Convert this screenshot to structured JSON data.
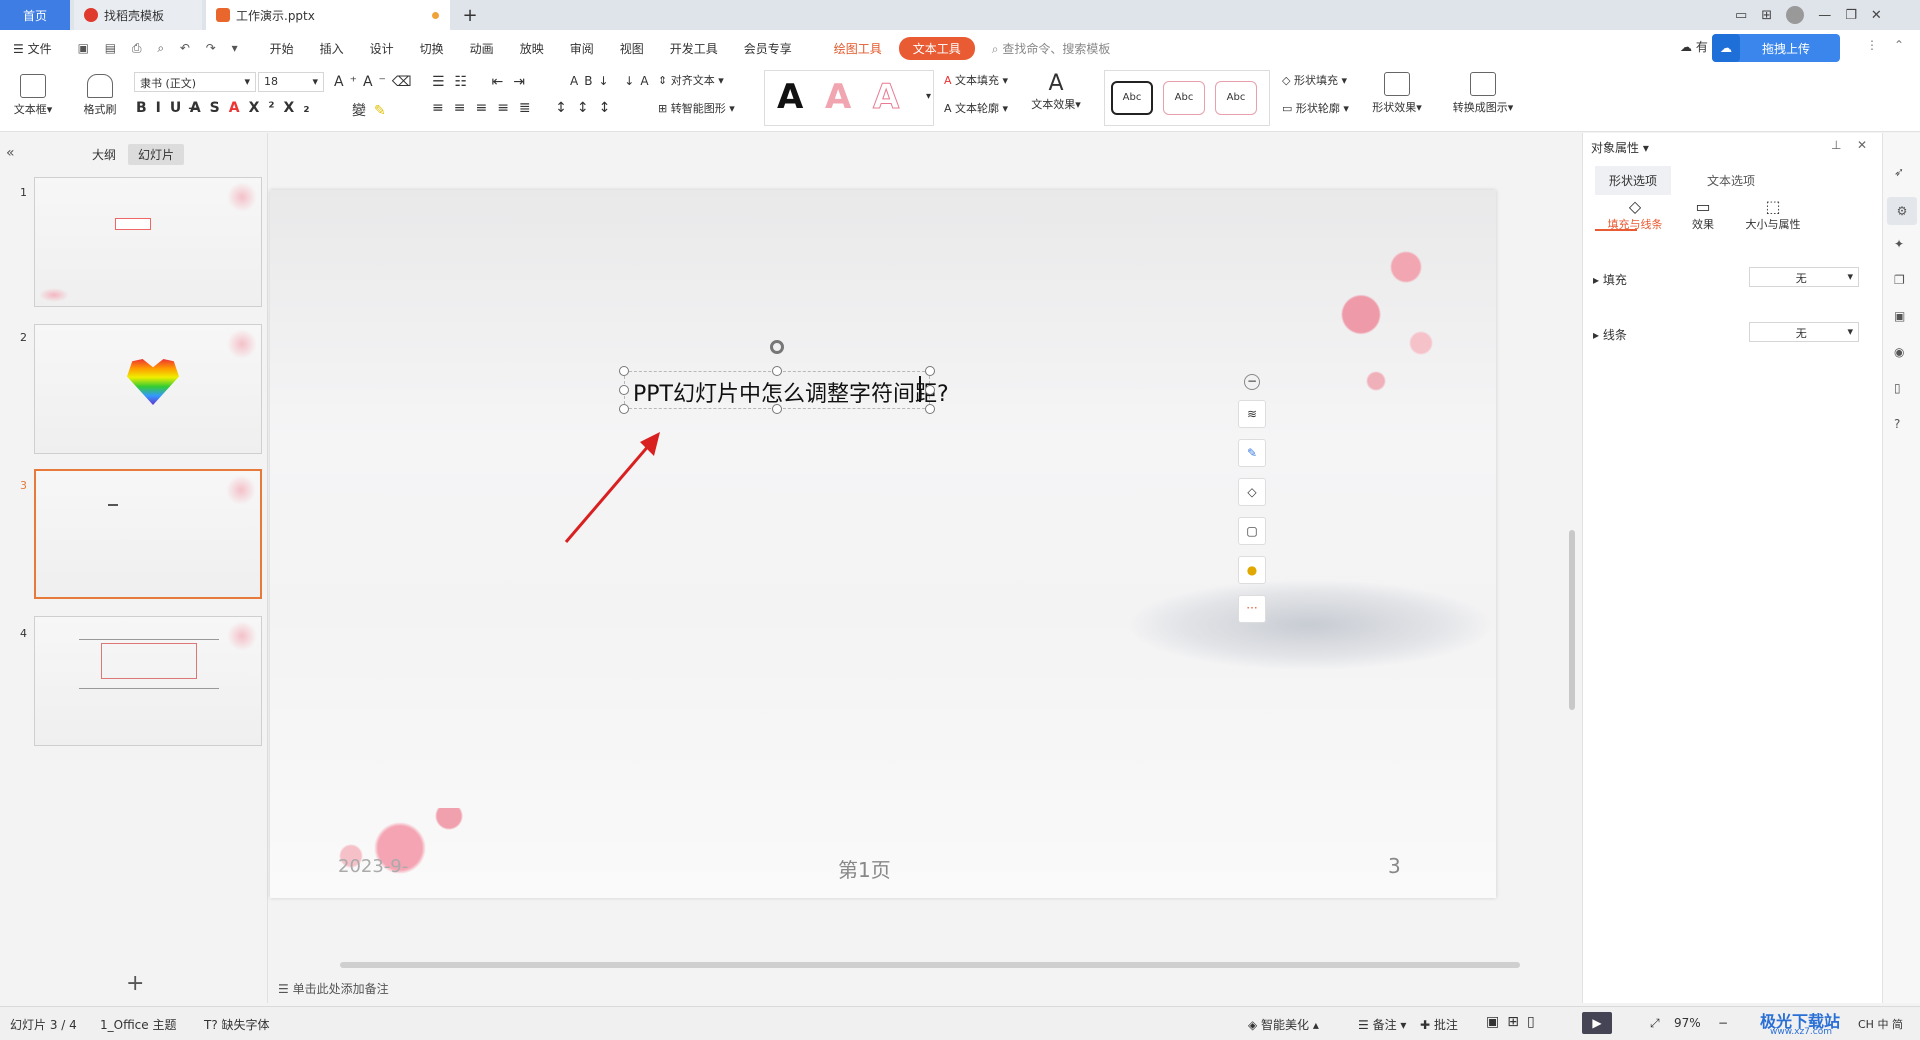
{
  "titlebar": {
    "tabs": [
      {
        "label": "首页"
      },
      {
        "label": "找稻壳模板"
      },
      {
        "label": "工作演示.pptx"
      }
    ],
    "new_tab": "+"
  },
  "menubar": {
    "file": "文件",
    "items": [
      "开始",
      "插入",
      "设计",
      "切换",
      "动画",
      "放映",
      "审阅",
      "视图",
      "开发工具",
      "会员专享"
    ],
    "drawing_tools": "绘图工具",
    "text_tools": "文本工具",
    "search_placeholder": "查找命令、搜索模板",
    "upload_btn": "拖拽上传",
    "cloud_partial": "有"
  },
  "ribbon": {
    "textbox": "文本框",
    "format_painter": "格式刷",
    "font": "隶书 (正文)",
    "size": "18",
    "align_text": "对齐文本",
    "smart_shape": "转智能图形",
    "text_fill": "文本填充",
    "text_outline": "文本轮廓",
    "text_effect": "文本效果",
    "shape_fill": "形状填充",
    "shape_outline": "形状轮廓",
    "shape_effect": "形状效果",
    "convert_diagram": "转换成图示",
    "wordart_letter": "A",
    "style_sample": "Abc"
  },
  "leftpanel": {
    "tab_outline": "大纲",
    "tab_slides": "幻灯片",
    "slide_numbers": [
      "1",
      "2",
      "3",
      "4"
    ],
    "add": "+"
  },
  "slide": {
    "title_text": "PPT幻灯片中怎么调整字符间距?",
    "date": "2023-9-",
    "page": "第1页",
    "number": "3"
  },
  "notes": {
    "placeholder": "单击此处添加备注"
  },
  "rightpanel": {
    "title": "对象属性",
    "tab_shape": "形状选项",
    "tab_text": "文本选项",
    "sub_fill_line": "填充与线条",
    "sub_effect": "效果",
    "sub_size": "大小与属性",
    "fill_label": "填充",
    "fill_value": "无",
    "line_label": "线条",
    "line_value": "无"
  },
  "status": {
    "slide_count": "幻灯片 3 / 4",
    "theme": "1_Office 主题",
    "missing_font": "缺失字体",
    "beautify": "智能美化",
    "notes": "备注",
    "comments": "批注",
    "zoom": "97%",
    "watermark": "极光下载站",
    "watermark_url": "www.xz7.com",
    "ime": "CH 中 简"
  },
  "colors": {
    "accent": "#e95b32",
    "home_tab": "#3e7de3",
    "selected_thumb": "#e77a3a"
  }
}
